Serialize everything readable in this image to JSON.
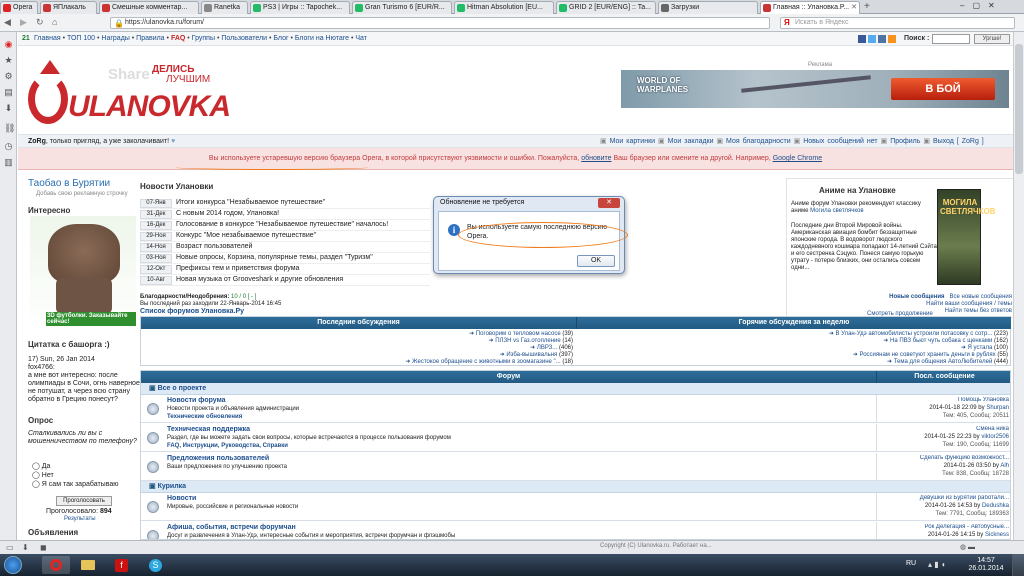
{
  "browser": {
    "tabs": [
      {
        "label": "Opera",
        "color": "#d22"
      },
      {
        "label": "ЯПлакаль",
        "color": "#c33"
      },
      {
        "label": "Смешные комментар...",
        "color": "#c33"
      },
      {
        "label": "Ranetka",
        "color": "#888"
      },
      {
        "label": "PS3 | Игры :: Tapochek...",
        "color": "#2b6"
      },
      {
        "label": "Gran Turismo 6 [EUR/R...",
        "color": "#2b6"
      },
      {
        "label": "Hitman Absolution [EU...",
        "color": "#2b6"
      },
      {
        "label": "GRID 2 [EUR/ENG] :: Ta...",
        "color": "#2b6"
      },
      {
        "label": "Загрузки",
        "color": "#666"
      },
      {
        "label": "Главная :: Улановка.Р...",
        "color": "#c33"
      }
    ],
    "url": "https://ulanovka.ru/forum/",
    "search_placeholder": "Искать в Яндекс"
  },
  "site": {
    "topnav": {
      "count": "21",
      "items": [
        "Главная",
        "ТОП 100",
        "Награды",
        "Правила",
        "FAQ",
        "Группы",
        "Пользователи",
        "Блог",
        "Блоги на Нютаге",
        "Чат"
      ],
      "search_label": "Поиск :",
      "search_button": "Ургше!"
    },
    "logo": {
      "share": "Share",
      "delis": "ДЕЛИСЬ",
      "luchshim": "ЛУЧШИМ",
      "name": "ULANOVKA"
    },
    "ad": {
      "label": "Реклама",
      "game": "WORLD OF WARPLANES",
      "cta": "В БОЙ"
    },
    "userbar": {
      "greeting_user": "ZoRg",
      "greeting_text": ", только пригляд, а уже заколачиваит!",
      "links": [
        "Мои картинки",
        "Мои закладки",
        "Моя благодарности",
        "Новых сообщений нет",
        "Профиль",
        "Выход [ ZoRg ]"
      ]
    },
    "warning": {
      "text": "Вы используете устаревшую версию браузера Opera, в которой присутствуют уязвимости и ошибки. Пожалуйста,",
      "update": "обновите",
      "text2": "Ваш браузер или смените на другой. Например,",
      "chrome": "Google Chrome"
    },
    "left": {
      "taobao": "Таобао в Бурятии",
      "taobao_sub": "Добавь свою рекламную строчку",
      "interesting": "Интересно",
      "hippo_caption": "3D футболки. Заказывайте сейчас!",
      "bash_title": "Цитатка с башорга :)",
      "bash_date": "17) Sun, 26 Jan 2014",
      "bash_user": "fox4766:",
      "bash_text": "а мне вот интересно: после олимпиады в Сочи, огнь наверное не потушат, а через всю страну обратно в Грецию понесут?",
      "poll_title": "Опрос",
      "poll_question": "Сталкивались ли вы с мошенничеством по телефону?",
      "poll_options": [
        "Да",
        "Нет",
        "Я сам так зарабатываю"
      ],
      "poll_button": "Проголосовать",
      "poll_voted_label": "Проголосовало:",
      "poll_voted": "894",
      "poll_results": "Результаты",
      "announce_title": "Объявления"
    },
    "news": {
      "title": "Новости Улановки",
      "items": [
        {
          "date": "07-Янв",
          "text": "Итоги конкурса \"Незабываемое путешествие\""
        },
        {
          "date": "31-Дек",
          "text": "С новым 2014 годом, Улановка!"
        },
        {
          "date": "16-Дек",
          "text": "Голосование в конкурсе \"Незабываемое путешествие\" началось!"
        },
        {
          "date": "29-Ноя",
          "text": "Конкурс \"Мое незабываемое путешествие\""
        },
        {
          "date": "14-Ноя",
          "text": "Возраст пользователей"
        },
        {
          "date": "03-Ноя",
          "text": "Новые опросы, Корзина, популярные темы, раздел \"Туризм\""
        },
        {
          "date": "12-Окт",
          "text": "Префиксы тем и приветствия форума"
        },
        {
          "date": "10-Авг",
          "text": "Новая музыка от Grooveshark и другие обновления"
        }
      ],
      "thanks": "Благодарности/Неодобрения:",
      "thanks_val": "10 / 0 [ - ]",
      "last_visit": "Вы последний раз заходили 22-Январь-2014 16:45",
      "forums_list": "Список форумов Улановка.Ру"
    },
    "anime": {
      "title": "Аниме на Улановке",
      "text1": "Аниме форум Улановки рекомендует классику аниме",
      "text_link": "Могила светлячков",
      "text2": "Последние дни Второй Мировой войны. Американская авиация бомбит беззащитные японские города. В водоворот людского каждодневного кошмара попадают 14-летний Сэйта и его сестренка Сэцуко. Понеся самую горькую утрату - потерю близких, они остались совсем одни...",
      "poster_title": "МОГИЛА СВЕТЛЯЧКОВ",
      "more": "Смотреть продолжение"
    },
    "quicklinks": [
      {
        "a": "Новые сообщения",
        "b": "Все новые сообщения"
      },
      {
        "a": "",
        "b": "Найти ваши сообщения / темы"
      },
      {
        "a": "",
        "b": "Найти темы без ответов"
      }
    ],
    "recent": {
      "left_title": "Последние обсуждения",
      "right_title": "Горячие обсуждения за неделю",
      "left": [
        {
          "t": "Поговорим о тепловом насосе",
          "n": "(39)"
        },
        {
          "t": "ПЛЗН vs Газ.отопление",
          "n": "(14)"
        },
        {
          "t": "ЛВРЗ...",
          "n": "(406)"
        },
        {
          "t": "Изба-вышивальня",
          "n": "(397)"
        },
        {
          "t": "Жестокое обращение с животными в зоомагазине \"...",
          "n": "(18)"
        }
      ],
      "right": [
        {
          "t": "В Улан-Удэ автомобилисты устроили потасовку с сотр...",
          "n": "(223)"
        },
        {
          "t": "На ПВЗ бьют чуть собака с щенками",
          "n": "(162)"
        },
        {
          "t": "Я устала",
          "n": "(100)"
        },
        {
          "t": "Россиянам не советуют хранить деньги в рублях",
          "n": "(55)"
        },
        {
          "t": "Тема для общения АвтоЛюбителей",
          "n": "(444)"
        }
      ]
    },
    "forum": {
      "col_forum": "Форум",
      "col_last": "Посл. сообщение",
      "section1": "Все о проекте",
      "section2": "Курилка",
      "rows": [
        {
          "title": "Новости форума",
          "desc": "Новости проекта и объявления администрации",
          "sub": "Технические обновления",
          "last": "Помощь Улановка",
          "date": "2014-01-18 22:09 by",
          "user": "Shurpan",
          "stats": "Тем: 405, Сообщ: 20511"
        },
        {
          "title": "Техническая поддержка",
          "desc": "Раздел, где вы можете задать свои вопросы, которые встречаются в процессе пользования форумом",
          "sub": "FAQ, Инструкции, Руководства, Справки",
          "last": "Смена ника",
          "date": "2014-01-25 22:23 by",
          "user": "viktor2506",
          "stats": "Тем: 190, Сообщ: 11699"
        },
        {
          "title": "Предложения пользователей",
          "desc": "Ваши предложения по улучшению проекта",
          "sub": "",
          "last": "Сделать функцию возможност...",
          "date": "2014-01-26 03:50 by",
          "user": "Alh",
          "stats": "Тем: 838, Сообщ: 18728"
        },
        {
          "title": "Новости",
          "desc": "Мировые, российские и региональные новости",
          "sub": "",
          "last": "Девушки из Бурятии работали...",
          "date": "2014-01-26 14:53 by",
          "user": "Dedushka",
          "stats": "Тем: 7791, Сообщ: 189363"
        },
        {
          "title": "Афиша, события, встречи форумчан",
          "desc": "Досуг и развлечения в Улан-Удэ, интересные события и мероприятия, встречи форумчан и флэшмобы",
          "sub": "",
          "last": "Рок Делегация - Автобусные...",
          "date": "2014-01-26 14:15 by",
          "user": "Sickness",
          "stats": ""
        }
      ]
    }
  },
  "dialog": {
    "title": "Обновление не требуется",
    "message": "Вы используете самую последнюю версию Opera.",
    "ok": "OK"
  },
  "statusbar": {
    "copyright": "Copyright (C) Ulanovka.ru. Работает на..."
  },
  "taskbar": {
    "lang": "RU",
    "time": "14:57",
    "date": "26.01.2014"
  }
}
